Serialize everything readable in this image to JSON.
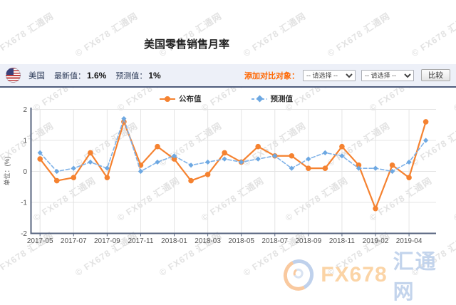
{
  "watermark": {
    "tile_text": "© FX678 汇通网"
  },
  "header": {
    "title": "美国零售销售月率"
  },
  "info_bar": {
    "country": "美国",
    "latest_label": "最新值：",
    "latest_value": "1.6%",
    "forecast_label": "预测值：",
    "forecast_value": "1%",
    "compare_label": "添加对比对象：",
    "select_placeholder": "-- 请选择 --",
    "compare_button": "比较"
  },
  "legend": {
    "items": [
      {
        "name": "公布值",
        "color": "#f58230",
        "line": "solid",
        "marker": "circle"
      },
      {
        "name": "预测值",
        "color": "#7fb2e8",
        "line": "dashed",
        "marker": "diamond"
      }
    ]
  },
  "footer_logo": {
    "fx": "FX678",
    "cn": "汇通网"
  },
  "chart_data": {
    "type": "line",
    "title": "美国零售销售月率",
    "categories": [
      "2017-05",
      "2017-06",
      "2017-07",
      "2017-08",
      "2017-09",
      "2017-10",
      "2017-11",
      "2017-12",
      "2018-01",
      "2018-02",
      "2018-03",
      "2018-04",
      "2018-05",
      "2018-06",
      "2018-07",
      "2018-08",
      "2018-09",
      "2018-10",
      "2018-11",
      "2018-12",
      "2019-02",
      "2019-03",
      "2019-04",
      "2019-04"
    ],
    "x_tick_labels": [
      "2017-05",
      "2017-07",
      "2017-09",
      "2017-11",
      "2018-01",
      "2018-03",
      "2018-05",
      "2018-07",
      "2018-09",
      "2018-11",
      "2019-02",
      "2019-04"
    ],
    "series": [
      {
        "name": "公布值",
        "color": "#f58230",
        "style": "solid",
        "marker": "circle",
        "values": [
          0.4,
          -0.3,
          -0.2,
          0.6,
          -0.2,
          1.6,
          0.2,
          0.8,
          0.4,
          -0.3,
          -0.1,
          0.6,
          0.3,
          0.8,
          0.5,
          0.5,
          0.1,
          0.1,
          0.8,
          0.2,
          -1.2,
          0.2,
          -0.2,
          1.6
        ]
      },
      {
        "name": "预测值",
        "color": "#7fb2e8",
        "style": "dashed",
        "marker": "diamond",
        "values": [
          0.6,
          0.0,
          0.1,
          0.3,
          0.1,
          1.7,
          0.0,
          0.3,
          0.5,
          0.2,
          0.3,
          0.4,
          0.3,
          0.4,
          0.5,
          0.1,
          0.4,
          0.6,
          0.5,
          0.1,
          0.1,
          0.0,
          0.3,
          1.0
        ]
      }
    ],
    "xlabel": "",
    "ylabel": "单位：(%)",
    "ylim": [
      -2,
      2
    ],
    "yticks": [
      2,
      1,
      0,
      -1,
      -2
    ],
    "grid": true,
    "legend_position": "top-center"
  }
}
